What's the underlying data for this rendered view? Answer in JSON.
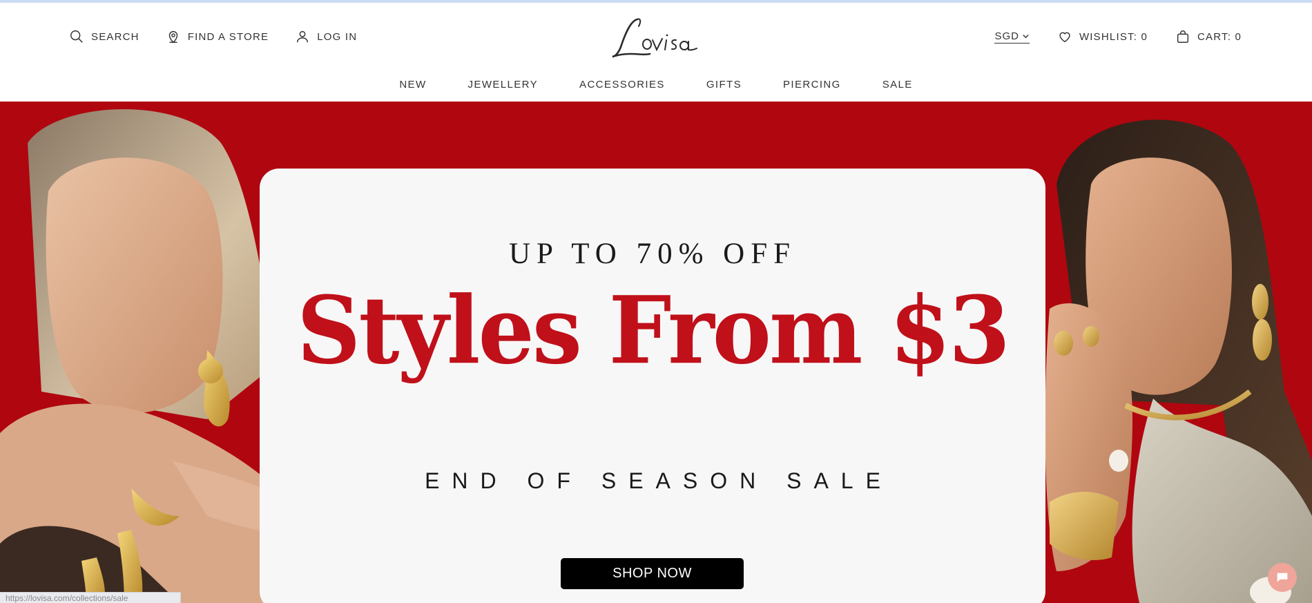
{
  "header": {
    "utility_left": [
      {
        "label": "SEARCH",
        "icon": "search-icon"
      },
      {
        "label": "FIND A STORE",
        "icon": "location-pin-icon"
      },
      {
        "label": "LOG IN",
        "icon": "user-icon"
      }
    ],
    "logo_text": "Lovisa",
    "currency": "SGD",
    "wishlist_label": "WISHLIST: 0",
    "cart_label": "CART: 0"
  },
  "nav": {
    "items": [
      "NEW",
      "JEWELLERY",
      "ACCESSORIES",
      "GIFTS",
      "PIERCING",
      "SALE"
    ]
  },
  "hero": {
    "background_color": "#b0060f",
    "eyebrow": "UP TO 70% OFF",
    "headline": "Styles From $3",
    "subheading": "END OF SEASON SALE",
    "cta_label": "SHOP NOW",
    "headline_color": "#c0101a"
  },
  "status_bar": {
    "url": "https://lovisa.com/collections/sale"
  },
  "chat": {
    "icon": "chat-icon",
    "color": "#f0a59a"
  }
}
